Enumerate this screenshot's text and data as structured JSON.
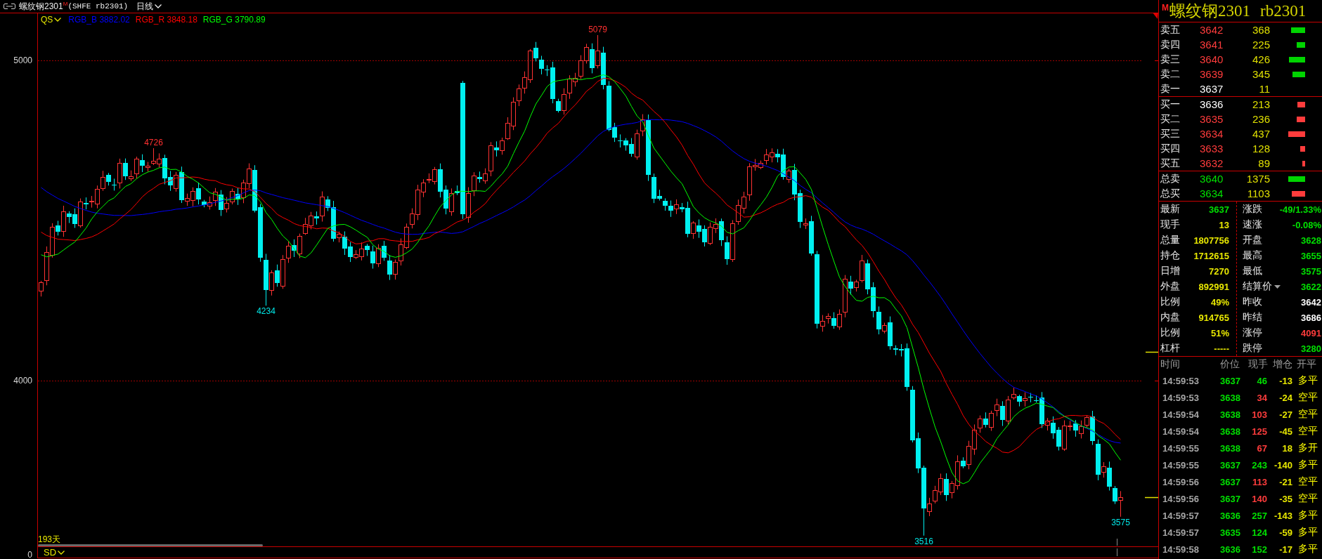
{
  "title_bar": {
    "name": "螺纹钢2301",
    "badge": "M",
    "code": "(SHFE rb2301)",
    "period": "日线"
  },
  "chart": {
    "indicator": "QS",
    "legend": [
      {
        "name": "RGB_B",
        "value": "3882.02",
        "color": "#0000ff"
      },
      {
        "name": "RGB_R",
        "value": "3848.18",
        "color": "#ff0000"
      },
      {
        "name": "RGB_G",
        "value": "3790.89",
        "color": "#00ff00"
      }
    ],
    "y_axis": [
      "5000",
      "4000"
    ],
    "price_labels": [
      {
        "kind": "high",
        "text": "5079"
      },
      {
        "kind": "high",
        "text": "4726"
      },
      {
        "kind": "low",
        "text": "4234"
      },
      {
        "kind": "low",
        "text": "3516"
      },
      {
        "kind": "low",
        "text": "3575"
      }
    ],
    "bar_count": "193天"
  },
  "sub_chart": {
    "indicator": "SD",
    "y_axis": [
      "0"
    ]
  },
  "quote_panel": {
    "badge": "M",
    "name": "螺纹钢2301",
    "code": "rb2301",
    "asks": [
      {
        "label": "卖五",
        "price": "3642",
        "color": "#ff3c3c",
        "volume": "368"
      },
      {
        "label": "卖四",
        "price": "3641",
        "color": "#ff3c3c",
        "volume": "225"
      },
      {
        "label": "卖三",
        "price": "3640",
        "color": "#ff3c3c",
        "volume": "426"
      },
      {
        "label": "卖二",
        "price": "3639",
        "color": "#ff3c3c",
        "volume": "345"
      },
      {
        "label": "卖一",
        "price": "3637",
        "color": "#ffffff",
        "volume": "11"
      }
    ],
    "bids": [
      {
        "label": "买一",
        "price": "3636",
        "color": "#ffffff",
        "volume": "213"
      },
      {
        "label": "买二",
        "price": "3635",
        "color": "#ff3c3c",
        "volume": "236"
      },
      {
        "label": "买三",
        "price": "3634",
        "color": "#ff3c3c",
        "volume": "437"
      },
      {
        "label": "买四",
        "price": "3633",
        "color": "#ff3c3c",
        "volume": "128"
      },
      {
        "label": "买五",
        "price": "3632",
        "color": "#ff3c3c",
        "volume": "89"
      }
    ],
    "totals": [
      {
        "kind": "ask",
        "label": "总卖",
        "price": "3640",
        "color": "#00e000",
        "volume": "1375"
      },
      {
        "kind": "bid",
        "label": "总买",
        "price": "3634",
        "color": "#00e000",
        "volume": "1103"
      }
    ],
    "stats_left": [
      {
        "label": "最新",
        "value": "3637",
        "color": "#00e000"
      },
      {
        "label": "现手",
        "value": "13",
        "color": "#e8e800"
      },
      {
        "label": "总量",
        "value": "1807756",
        "color": "#e8e800"
      },
      {
        "label": "持仓",
        "value": "1712615",
        "color": "#e8e800"
      },
      {
        "label": "日增",
        "value": "7270",
        "color": "#e8e800"
      },
      {
        "label": "外盘",
        "value": "892991",
        "color": "#e8e800"
      },
      {
        "label": "比例",
        "value": "49%",
        "color": "#e8e800"
      },
      {
        "label": "内盘",
        "value": "914765",
        "color": "#e8e800"
      },
      {
        "label": "比例",
        "value": "51%",
        "color": "#e8e800"
      },
      {
        "label": "杠杆",
        "value": "-----",
        "color": "#e8e800"
      }
    ],
    "stats_right": [
      {
        "kind": "plain",
        "label": "涨跌",
        "value": "-49/1.33%",
        "color": "#00e000"
      },
      {
        "kind": "plain",
        "label": "速涨",
        "value": "-0.08%",
        "color": "#00e000"
      },
      {
        "kind": "plain",
        "label": "开盘",
        "value": "3628",
        "color": "#00e000"
      },
      {
        "kind": "plain",
        "label": "最高",
        "value": "3655",
        "color": "#00e000"
      },
      {
        "kind": "plain",
        "label": "最低",
        "value": "3575",
        "color": "#00e000"
      },
      {
        "kind": "dropdown",
        "label": "结算价",
        "value": "3622",
        "color": "#00e000"
      },
      {
        "kind": "plain",
        "label": "昨收",
        "value": "3642",
        "color": "#ffffff"
      },
      {
        "kind": "plain",
        "label": "昨结",
        "value": "3686",
        "color": "#ffffff"
      },
      {
        "kind": "plain",
        "label": "涨停",
        "value": "4091",
        "color": "#ff3c3c"
      },
      {
        "kind": "plain",
        "label": "跌停",
        "value": "3280",
        "color": "#00e000"
      }
    ],
    "trades_header": [
      "时间",
      "价位",
      "现手",
      "增仓",
      "开平"
    ],
    "trades": [
      {
        "time": "14:59:53",
        "price": "3637",
        "volume": "46",
        "color": "#00e000",
        "change": "-13",
        "type": "多平"
      },
      {
        "time": "14:59:53",
        "price": "3638",
        "volume": "34",
        "color": "#ff3c3c",
        "change": "-24",
        "type": "空平"
      },
      {
        "time": "14:59:54",
        "price": "3638",
        "volume": "103",
        "color": "#ff3c3c",
        "change": "-27",
        "type": "空平"
      },
      {
        "time": "14:59:54",
        "price": "3638",
        "volume": "125",
        "color": "#ff3c3c",
        "change": "-45",
        "type": "空平"
      },
      {
        "time": "14:59:55",
        "price": "3638",
        "volume": "67",
        "color": "#ff3c3c",
        "change": "18",
        "type": "多开"
      },
      {
        "time": "14:59:55",
        "price": "3637",
        "volume": "243",
        "color": "#00e000",
        "change": "-140",
        "type": "多平"
      },
      {
        "time": "14:59:56",
        "price": "3637",
        "volume": "113",
        "color": "#ff3c3c",
        "change": "-21",
        "type": "空平"
      },
      {
        "time": "14:59:56",
        "price": "3637",
        "volume": "140",
        "color": "#ff3c3c",
        "change": "-35",
        "type": "空平"
      },
      {
        "time": "14:59:57",
        "price": "3636",
        "volume": "257",
        "color": "#00e000",
        "change": "-143",
        "type": "多平"
      },
      {
        "time": "14:59:57",
        "price": "3635",
        "volume": "124",
        "color": "#00e000",
        "change": "-59",
        "type": "多平"
      },
      {
        "time": "14:59:58",
        "price": "3636",
        "volume": "152",
        "color": "#00e000",
        "change": "-17",
        "type": "多平"
      }
    ]
  }
}
